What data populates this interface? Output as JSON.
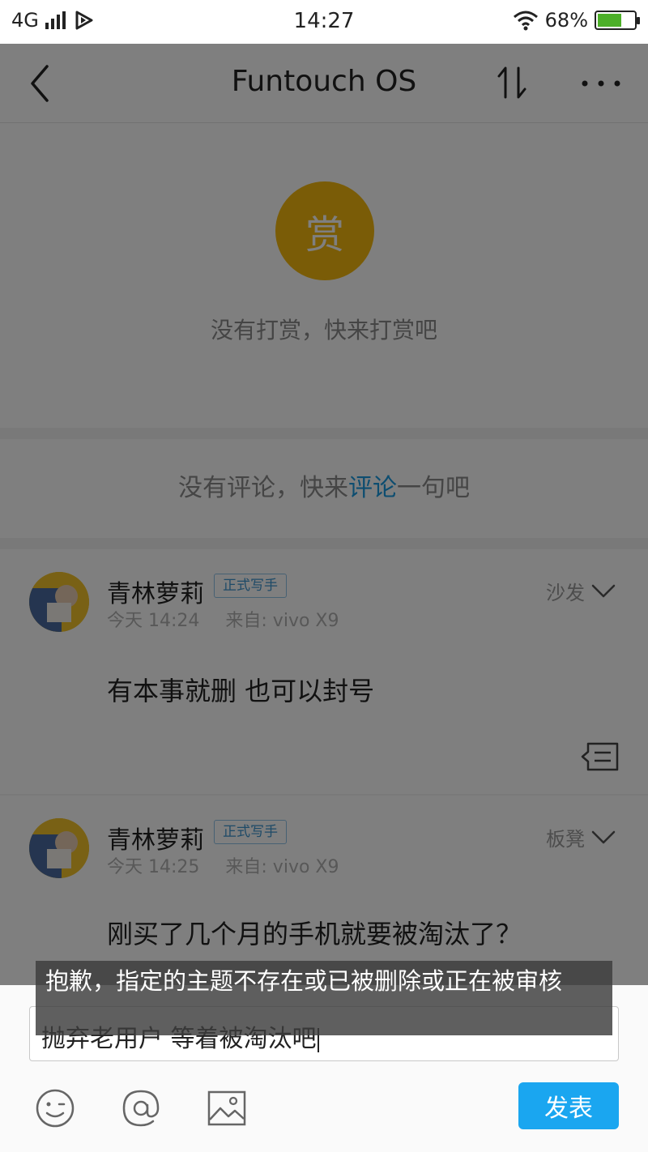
{
  "status_bar": {
    "network": "4G",
    "time": "14:27",
    "battery": "68%"
  },
  "header": {
    "title": "Funtouch OS"
  },
  "reward": {
    "coin_label": "赏",
    "hint": "没有打赏，快来打赏吧"
  },
  "comments": {
    "empty_prefix": "没有评论，快来",
    "empty_link": "评论",
    "empty_suffix": "一句吧"
  },
  "replies": [
    {
      "author": "青林萝莉",
      "badge": "正式写手",
      "time": "今天 14:24",
      "source": "来自: vivo X9",
      "floor": "沙发",
      "content": "有本事就删   也可以封号"
    },
    {
      "author": "青林萝莉",
      "badge": "正式写手",
      "time": "今天 14:25",
      "source": "来自: vivo X9",
      "floor": "板凳",
      "content": "刚买了几个月的手机就要被淘汰了？"
    }
  ],
  "composer": {
    "input_value": "抛弃老用户   等着被淘汰吧",
    "send_label": "发表"
  },
  "toast": {
    "message": "抱歉，指定的主题不存在或已被删除或正在被审核"
  },
  "icons": {
    "back": "back-arrow-icon",
    "sort": "sort-icon",
    "more": "more-dots-icon",
    "emoji": "emoji-icon",
    "mention": "at-mention-icon",
    "image": "image-icon",
    "reply": "reply-comment-icon"
  },
  "colors": {
    "accent": "#1aa6f0",
    "coin": "#f5b80f",
    "link": "#1a9be0"
  }
}
